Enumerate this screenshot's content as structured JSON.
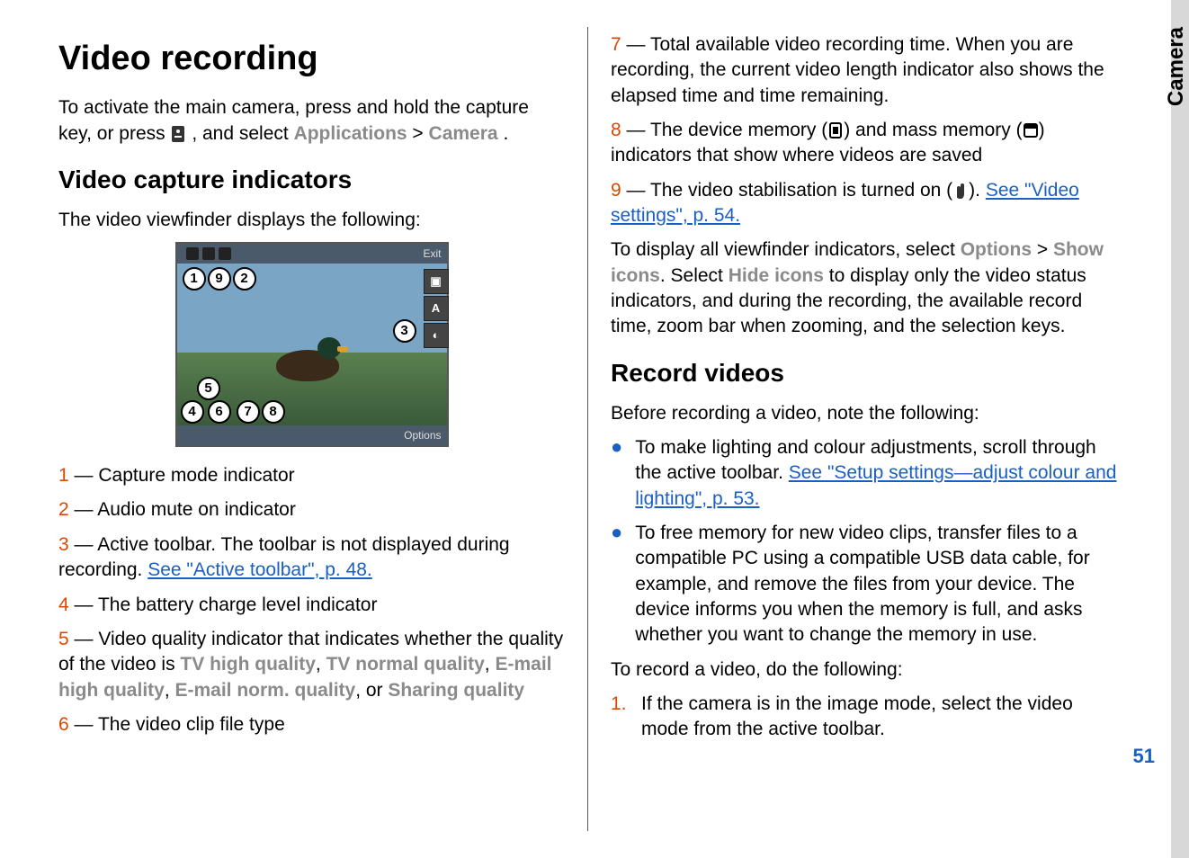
{
  "side_tab": "Camera",
  "page_number": "51",
  "left": {
    "h1": "Video recording",
    "intro_a": "To activate the main camera, press and hold the capture key, or press ",
    "intro_b": " , and select ",
    "intro_app": "Applications",
    "intro_sep": "  > ",
    "intro_cam": "Camera",
    "intro_period": ".",
    "h2": "Video capture indicators",
    "vf_intro": "The video viewfinder displays the following:",
    "screenshot": {
      "exit": "Exit",
      "options": "Options",
      "side": {
        "a": "A"
      }
    },
    "items": {
      "i1n": "1",
      "i1t": " — Capture mode indicator",
      "i2n": "2",
      "i2t": " — Audio mute on indicator",
      "i3n": "3",
      "i3a": " — Active toolbar. The toolbar is not displayed during recording. ",
      "i3link": "See \"Active toolbar\", p. 48.",
      "i4n": "4",
      "i4t": " — The battery charge level indicator",
      "i5n": "5",
      "i5a": " — Video quality indicator that indicates whether the quality of the video is ",
      "i5b": "TV high quality",
      "i5s1": ", ",
      "i5c": "TV normal quality",
      "i5s2": ", ",
      "i5d": "E-mail high quality",
      "i5s3": ", ",
      "i5e": "E-mail norm. quality",
      "i5s4": ", or ",
      "i5f": "Sharing quality",
      "i6n": "6",
      "i6t": " — The video clip file type"
    }
  },
  "right": {
    "i7n": "7",
    "i7t": " — Total available video recording time. When you are recording, the current video length indicator also shows the elapsed time and time remaining.",
    "i8n": "8",
    "i8a": " — The device memory (",
    "i8b": ") and mass memory (",
    "i8c": ") indicators that show where videos are saved",
    "i9n": "9",
    "i9a": " — The video stabilisation is turned on (",
    "i9b": "). ",
    "i9link": "See \"Video settings\", p. 54.",
    "para1a": "To display all viewfinder indicators, select ",
    "para1b": "Options",
    "para1c": "  > ",
    "para1d": "Show icons",
    "para1e": ". Select ",
    "para1f": "Hide icons",
    "para1g": " to display only the video status indicators, and during the recording, the available record time, zoom bar when zooming, and the selection keys.",
    "h2": "Record videos",
    "pre": "Before recording a video, note the following:",
    "b1a": "To make lighting and colour adjustments, scroll through the active toolbar. ",
    "b1link": "See \"Setup settings—adjust colour and lighting\", p. 53.",
    "b2": "To free memory for new video clips, transfer files to a compatible PC using a compatible USB data cable, for example, and remove the files from your device. The device informs you when the memory is full, and asks whether you want to change the memory in use.",
    "rec_intro": "To record a video, do the following:",
    "step1n": "1.",
    "step1": "If the camera is in the image mode, select the video mode from the active toolbar."
  }
}
